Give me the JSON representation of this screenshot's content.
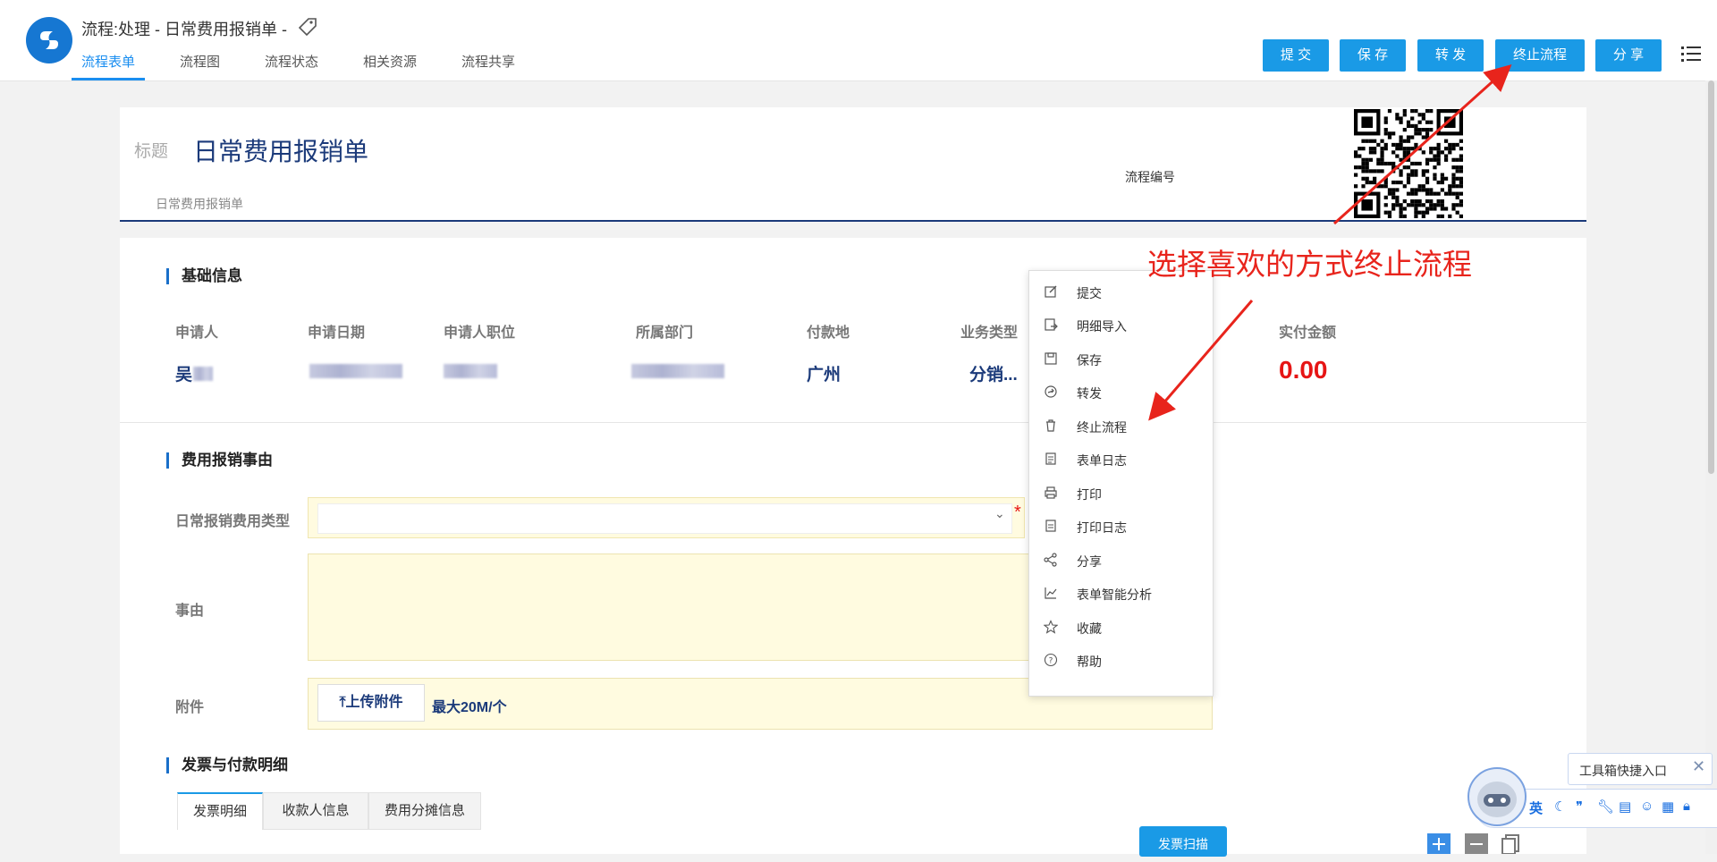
{
  "header": {
    "title": "流程:处理 - 日常费用报销单 -",
    "tabs": [
      {
        "label": "流程表单",
        "active": true
      },
      {
        "label": "流程图",
        "active": false
      },
      {
        "label": "流程状态",
        "active": false
      },
      {
        "label": "相关资源",
        "active": false
      },
      {
        "label": "流程共享",
        "active": false
      }
    ],
    "buttons": {
      "submit": "提 交",
      "save": "保 存",
      "forward": "转 发",
      "terminate": "终止流程",
      "share": "分 享"
    }
  },
  "form": {
    "title_label": "标题",
    "title": "日常费用报销单",
    "subtitle": "日常费用报销单",
    "flow_no_label": "流程编号",
    "basic": {
      "section": "基础信息",
      "labels": [
        "申请人",
        "申请日期",
        "申请人职位",
        "所属部门",
        "付款地",
        "业务类型",
        "实付金额"
      ],
      "applicant": "吴",
      "payment_location": "广州",
      "business_type": "分销...",
      "amount": "0.00"
    },
    "reason": {
      "section": "费用报销事由",
      "type_label": "日常报销费用类型",
      "type_value": "",
      "required_mark": "*",
      "reason_label": "事由",
      "attach_label": "附件",
      "upload_button": "上传附件",
      "max_size": "最大20M/个"
    },
    "invoice": {
      "section": "发票与付款明细",
      "tabs": [
        "发票明细",
        "收款人信息",
        "费用分摊信息"
      ],
      "scan_button": "发票扫描"
    }
  },
  "dropdown": {
    "items": [
      {
        "label": "提交",
        "icon": "edit-icon"
      },
      {
        "label": "明细导入",
        "icon": "import-icon"
      },
      {
        "label": "保存",
        "icon": "save-icon"
      },
      {
        "label": "转发",
        "icon": "forward-icon"
      },
      {
        "label": "终止流程",
        "icon": "trash-icon"
      },
      {
        "label": "表单日志",
        "icon": "log-icon"
      },
      {
        "label": "打印",
        "icon": "print-icon"
      },
      {
        "label": "打印日志",
        "icon": "print-log-icon"
      },
      {
        "label": "分享",
        "icon": "share-icon"
      },
      {
        "label": "表单智能分析",
        "icon": "chart-icon"
      },
      {
        "label": "收藏",
        "icon": "star-icon"
      },
      {
        "label": "帮助",
        "icon": "help-icon"
      }
    ]
  },
  "annotation": "选择喜欢的方式终止流程",
  "toolbox": {
    "tooltip": "工具箱快捷入口",
    "close": "✕",
    "lang": "英"
  },
  "colors": {
    "accent": "#1a9ae6",
    "navy": "#1b3a7a",
    "red": "#e61515"
  }
}
